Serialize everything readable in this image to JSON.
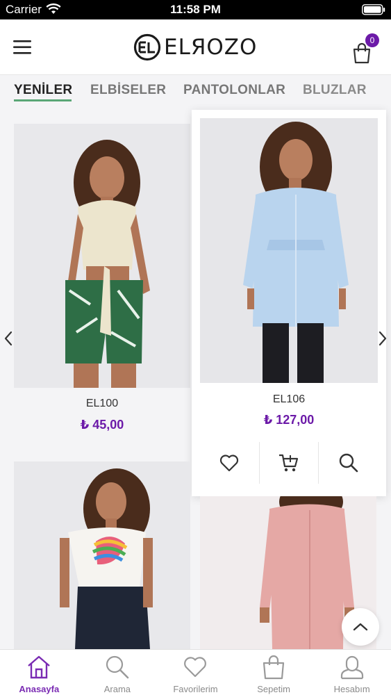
{
  "status_bar": {
    "carrier": "Carrier",
    "time": "11:58 PM"
  },
  "header": {
    "logo_text": "ELRozo",
    "cart_count": "0",
    "icons": [
      "menu-icon",
      "cart-icon"
    ]
  },
  "categories": [
    {
      "label": "YENİLER",
      "active": true
    },
    {
      "label": "ELBİSELER",
      "active": false
    },
    {
      "label": "PANTOLONLAR",
      "active": false
    },
    {
      "label": "BLUZLAR",
      "active": false
    }
  ],
  "products": [
    {
      "name": "EL100",
      "price": "₺ 45,00"
    },
    {
      "name": "EL106",
      "price": "₺ 127,00"
    },
    {
      "name": "",
      "price": ""
    },
    {
      "name": "",
      "price": ""
    }
  ],
  "product_actions": [
    "heart-icon",
    "cart-add-icon",
    "search-icon"
  ],
  "bottom_nav": [
    {
      "label": "Anasayfa",
      "icon": "home-icon",
      "active": true
    },
    {
      "label": "Arama",
      "icon": "search-icon",
      "active": false
    },
    {
      "label": "Favorilerim",
      "icon": "heart-icon",
      "active": false
    },
    {
      "label": "Sepetim",
      "icon": "bag-icon",
      "active": false
    },
    {
      "label": "Hesabım",
      "icon": "user-icon",
      "active": false
    }
  ],
  "colors": {
    "accent": "#6c1aa8",
    "tab_underline": "#5aa776",
    "price": "#6c1aa8"
  }
}
